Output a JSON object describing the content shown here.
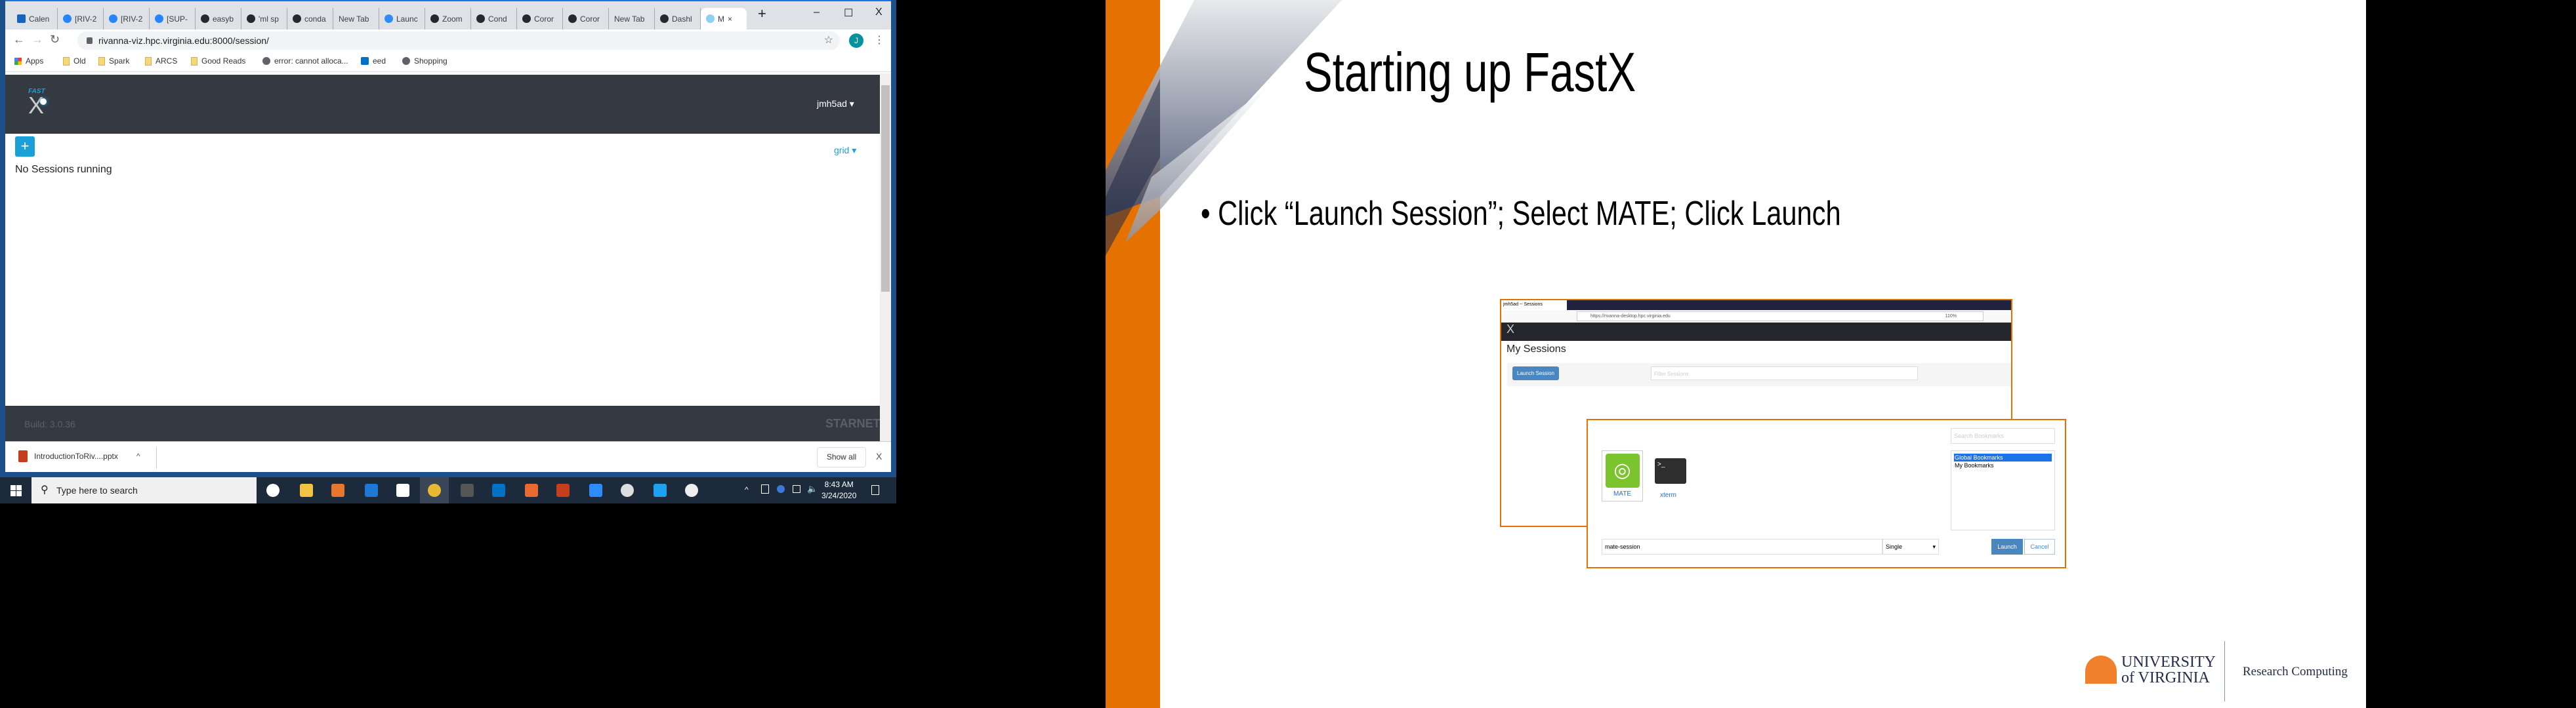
{
  "browser": {
    "tabs": [
      {
        "label": "Calen",
        "icon": "calendar-icon"
      },
      {
        "label": "[RIV-2",
        "icon": "jira-icon"
      },
      {
        "label": "[RIV-2",
        "icon": "jira-icon"
      },
      {
        "label": "[SUP-",
        "icon": "jira-icon"
      },
      {
        "label": "easyb",
        "icon": "github-icon"
      },
      {
        "label": "'ml sp",
        "icon": "github-icon"
      },
      {
        "label": "conda",
        "icon": "github-icon"
      },
      {
        "label": "New Tab",
        "icon": ""
      },
      {
        "label": "Launc",
        "icon": "zoom-icon"
      },
      {
        "label": "Zoom",
        "icon": "zoom-logo-icon"
      },
      {
        "label": "Cond",
        "icon": "github-icon"
      },
      {
        "label": "Coror",
        "icon": "news-icon"
      },
      {
        "label": "Coror",
        "icon": "globe-icon"
      },
      {
        "label": "New Tab",
        "icon": ""
      },
      {
        "label": "Dashl",
        "icon": "globe-icon"
      },
      {
        "label": "M",
        "icon": "fastx-icon"
      }
    ],
    "new_tab": "+",
    "minimize": "–",
    "maximize": "☐",
    "close": "X",
    "url": "rivanna-viz.hpc.virginia.edu:8000/session/",
    "avatar": "J",
    "bookmarks": [
      {
        "label": "Apps",
        "icon": "apps-icon"
      },
      {
        "label": "Old",
        "icon": "folder-icon"
      },
      {
        "label": "Spark",
        "icon": "folder-icon"
      },
      {
        "label": "ARCS",
        "icon": "folder-icon"
      },
      {
        "label": "Good Reads",
        "icon": "folder-icon"
      },
      {
        "label": "error: cannot alloca...",
        "icon": "globe-icon"
      },
      {
        "label": "eed",
        "icon": "outlook-icon"
      },
      {
        "label": "Shopping",
        "icon": "globe-icon"
      }
    ]
  },
  "fastx": {
    "logo": "FAST X",
    "user": "jmh5ad",
    "add": "+",
    "view": "grid",
    "empty": "No Sessions running",
    "build": "Build: 3.0.36",
    "powered": "STARNET"
  },
  "download": {
    "file": "IntroductionToRiv....pptx",
    "show_all": "Show all",
    "close": "X"
  },
  "taskbar": {
    "search": "Type here to search",
    "time": "8:43 AM",
    "date": "3/24/2020"
  },
  "slide": {
    "title": "Starting up FastX",
    "bullet": "Click “Launch Session”; Select MATE; Click Launch",
    "inset_back": {
      "tab": "jmh5ad -- Sessions",
      "url": "https://rivanna-desktop.hpc.virginia.edu",
      "zoom": "110%",
      "heading": "My Sessions",
      "launch": "Launch Session",
      "filter_placeholder": "Filter Sessions"
    },
    "inset_front": {
      "apps": [
        "MATE",
        "xterm"
      ],
      "search_placeholder": "Search Bookmarks",
      "bookmarks": [
        "Global Bookmarks",
        "My Bookmarks"
      ],
      "command": "mate-session",
      "mode": "Single",
      "launch": "Launch",
      "cancel": "Cancel"
    },
    "logo_text": "UNIVERSITY of VIRGINIA",
    "dept": "Research Computing"
  },
  "colors": {
    "accent": "#1a9fd8",
    "orange": "#e57200",
    "navy": "#232d4b",
    "dark": "#353a42"
  }
}
